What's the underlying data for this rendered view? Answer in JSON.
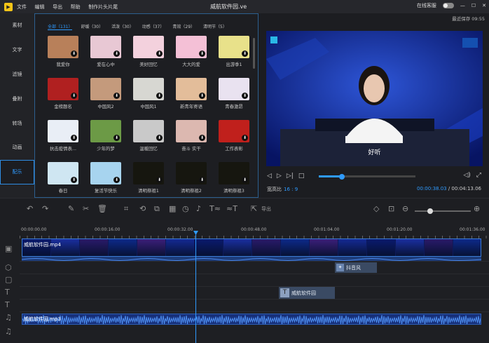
{
  "titlebar": {
    "menu": [
      "文件",
      "编辑",
      "导出",
      "帮助",
      "制作片头片尾"
    ],
    "title": "威航软件园.ve",
    "online_service": "在线客服",
    "window_controls": [
      "minimize-icon",
      "maximize-icon",
      "close-icon"
    ]
  },
  "leftnav": {
    "items": [
      "素材",
      "文字",
      "滤镜",
      "叠附",
      "转场",
      "动画",
      "配乐"
    ],
    "active_index": 6
  },
  "library": {
    "tabs": [
      "全部（131）",
      "舒缓（30）",
      "活泼（30）",
      "动感（37）",
      "青效（29）",
      "清明节（5）"
    ],
    "active_tab": 0,
    "items": [
      {
        "label": "我爱你",
        "color": "#b8805a"
      },
      {
        "label": "爱在心中",
        "color": "#e8c8d4"
      },
      {
        "label": "美好回忆",
        "color": "#f3d1dd"
      },
      {
        "label": "大大的爱",
        "color": "#f4c0d6"
      },
      {
        "label": "出游季1",
        "color": "#e8e18a"
      },
      {
        "label": "金榜题名",
        "color": "#b02020"
      },
      {
        "label": "中国风2",
        "color": "#c49a7c"
      },
      {
        "label": "中国风1",
        "color": "#d7d7d2"
      },
      {
        "label": "新青年寄语",
        "color": "#e3bd9a"
      },
      {
        "label": "青春激昂",
        "color": "#e9e2f0"
      },
      {
        "label": "抗击疫情表...",
        "color": "#e9eef6"
      },
      {
        "label": "少年的梦",
        "color": "#6c9a46"
      },
      {
        "label": "温暖回忆",
        "color": "#c9c9c9"
      },
      {
        "label": "奋斗 实干",
        "color": "#dcb8b0"
      },
      {
        "label": "工作表彰",
        "color": "#c0201c"
      },
      {
        "label": "春日",
        "color": "#cfe6f2"
      },
      {
        "label": "复活节快乐",
        "color": "#a7d4ef"
      },
      {
        "label": "清明祭祖1",
        "color": "#16160f"
      },
      {
        "label": "清明祭祖2",
        "color": "#16160f"
      },
      {
        "label": "清明祭祖3",
        "color": "#16160f"
      }
    ]
  },
  "preview": {
    "last_saved": "最近保存 09:55",
    "subtitle": "好听",
    "aspect_label": "宽高比",
    "aspect_value": "16 : 9",
    "current_time": "00:00:38.03",
    "total_time": "00:04:13.06",
    "separator": " / ",
    "progress_fraction": 0.24
  },
  "toolbar": {
    "export_label": "导出",
    "zoom_fraction": 0.27
  },
  "timeline": {
    "ruler": [
      "00:00:00.00",
      "00:00:16.00",
      "00:00:32.00",
      "00:00:48.00",
      "00:01:04.00",
      "00:01:20.00",
      "00:01:36.00"
    ],
    "video_clip": "威航软件园.mp4",
    "effect_clip": "抖音风",
    "text_clip": "威航软件园",
    "audio_clip": "威航软件园.mp3"
  },
  "colors": {
    "accent": "#2f9bff",
    "active_border": "#2f8de4"
  }
}
